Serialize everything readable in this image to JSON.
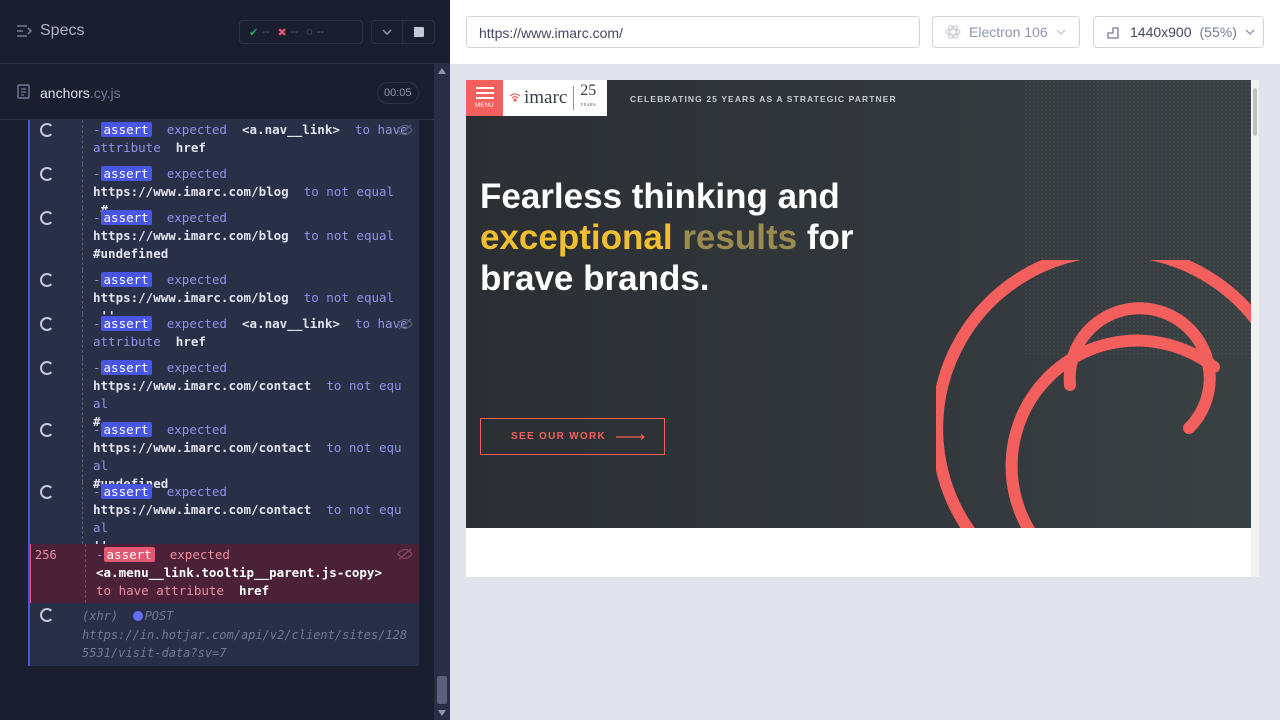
{
  "reporter": {
    "specs_label": "Specs",
    "stats": {
      "passed": "--",
      "failed": "--",
      "pending": "--"
    },
    "file": {
      "name": "anchors",
      "ext": ".cy.js",
      "duration": "00:05"
    },
    "commands": [
      {
        "dash": "-",
        "badge": "assert",
        "pre": "expected",
        "b1": "<a.nav__link>",
        "mid": "to have attribute",
        "b2": "href"
      },
      {
        "dash": "-",
        "badge": "assert",
        "pre": "expected",
        "b1": "https://www.imarc.com/blog",
        "mid": "to not equal",
        "b2": "#"
      },
      {
        "dash": "-",
        "badge": "assert",
        "pre": "expected",
        "b1": "https://www.imarc.com/blog",
        "mid": "to not equal",
        "b2": "#undefined"
      },
      {
        "dash": "-",
        "badge": "assert",
        "pre": "expected",
        "b1": "https://www.imarc.com/blog",
        "mid": "to not equal",
        "b2": "''"
      },
      {
        "dash": "-",
        "badge": "assert",
        "pre": "expected",
        "b1": "<a.nav__link>",
        "mid": "to have attribute",
        "b2": "href"
      },
      {
        "dash": "-",
        "badge": "assert",
        "pre": "expected",
        "b1": "https://www.imarc.com/contact",
        "mid": "to not equal",
        "b2": "#"
      },
      {
        "dash": "-",
        "badge": "assert",
        "pre": "expected",
        "b1": "https://www.imarc.com/contact",
        "mid": "to not equal",
        "b2": "#undefined"
      },
      {
        "dash": "-",
        "badge": "assert",
        "pre": "expected",
        "b1": "https://www.imarc.com/contact",
        "mid": "to not equal",
        "b2": "''"
      }
    ],
    "failed_command": {
      "line": "256",
      "dash": "-",
      "badge": "assert",
      "pre": "expected",
      "b1": "<a.menu__link.tooltip__parent.js-copy>",
      "mid": "to have attribute",
      "b2": "href"
    },
    "xhr_command": {
      "type": "(xhr)",
      "method": "POST",
      "url": "https://in.hotjar.com/api/v2/client/sites/1285531/visit-data?sv=7"
    }
  },
  "aut_header": {
    "url": "https://www.imarc.com/",
    "browser": "Electron 106",
    "viewport": "1440x900",
    "scale": "(55%)"
  },
  "site": {
    "menu_label": "MENU",
    "logo_word": "imarc",
    "logo_years": "25",
    "logo_years_small": "YEARS",
    "tagline": "CELEBRATING 25 YEARS AS A STRATEGIC PARTNER",
    "headline_1": "Fearless thinking and",
    "headline_y1": "exceptional",
    "headline_y2": "results",
    "headline_for": "for",
    "headline_3": "brave brands.",
    "cta": "SEE OUR WORK"
  },
  "colors": {
    "accent_coral": "#f25f5c",
    "headline_yellow": "#f0be2e",
    "cypress_blue": "#4956e3",
    "fail_red": "#e45770"
  }
}
